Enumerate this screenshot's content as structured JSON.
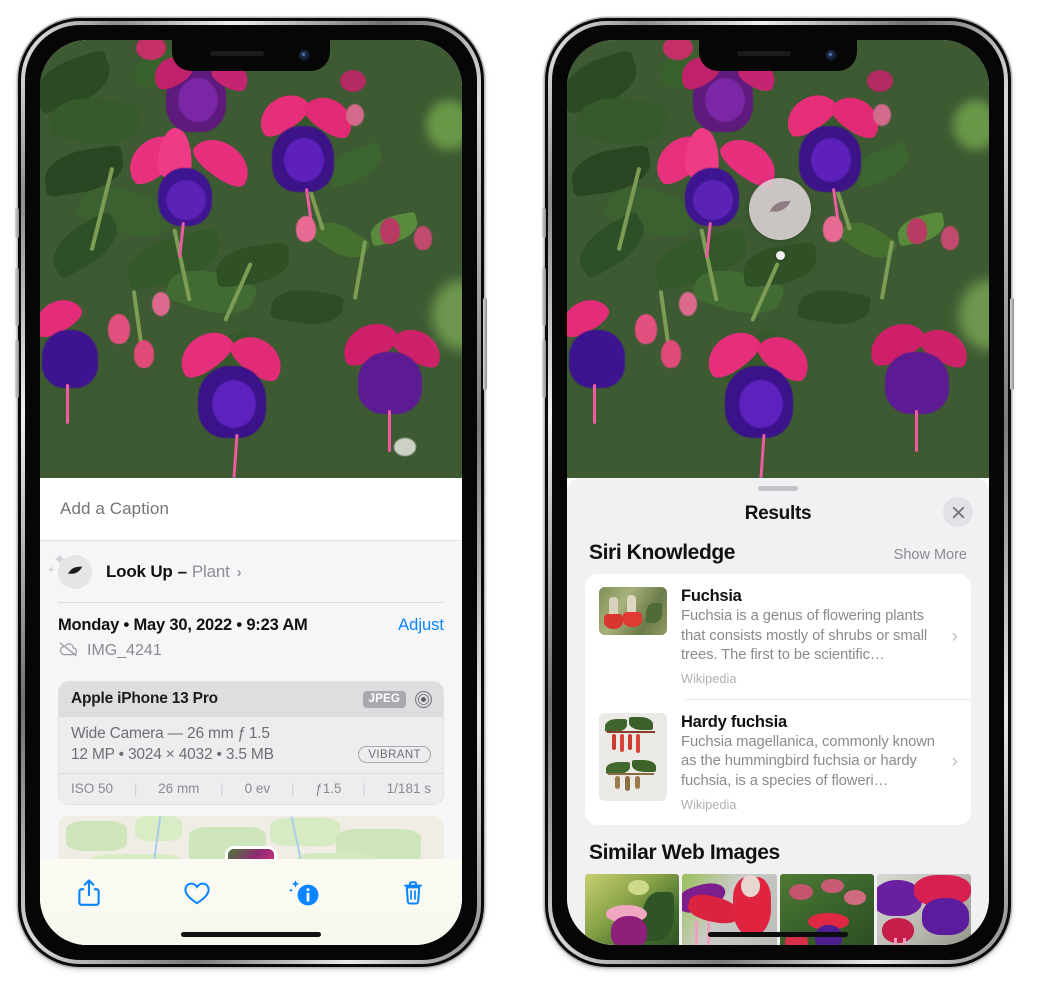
{
  "left_phone": {
    "photo": {
      "alt": "fuchsia-flowers-photo"
    },
    "caption": {
      "placeholder": "Add a Caption",
      "value": ""
    },
    "lookup": {
      "icon": "leaf-icon",
      "label": "Look Up",
      "dash": "–",
      "subject": "Plant",
      "chevron": "›"
    },
    "meta": {
      "date": "Monday • May 30, 2022 • 9:23 AM",
      "adjust_label": "Adjust",
      "cloud_icon": "cloud-slash-icon",
      "filename": "IMG_4241"
    },
    "camera": {
      "device": "Apple iPhone 13 Pro",
      "format_badge": "JPEG",
      "aperture_icon": "aperture-icon",
      "lens_line": "Wide Camera — 26 mm ƒ 1.5",
      "detail_line": "12 MP • 3024 × 4032 • 3.5 MB",
      "style_badge": "VIBRANT",
      "exif": [
        "ISO 50",
        "26 mm",
        "0 ev",
        "ƒ1.5",
        "1/181 s"
      ]
    },
    "toolbar": [
      {
        "name": "share-icon",
        "label": "Share"
      },
      {
        "name": "heart-icon",
        "label": "Favorite"
      },
      {
        "name": "info-sparkle-icon",
        "label": "Info"
      },
      {
        "name": "trash-icon",
        "label": "Delete"
      }
    ]
  },
  "right_phone": {
    "photo_badge": {
      "icon": "leaf-icon",
      "label": "Visual Look Up plant badge"
    },
    "sheet": {
      "grabber": "drag-handle",
      "title": "Results",
      "close_icon": "close-icon"
    },
    "siri_knowledge": {
      "title": "Siri Knowledge",
      "show_more": "Show More",
      "items": [
        {
          "title": "Fuchsia",
          "description": "Fuchsia is a genus of flowering plants that consists mostly of shrubs or small trees. The first to be scientific…",
          "source": "Wikipedia",
          "chevron": "›",
          "thumb": "fuchsia-red-flowers-thumbnail"
        },
        {
          "title": "Hardy fuchsia",
          "description": "Fuchsia magellanica, commonly known as the hummingbird fuchsia or hardy fuchsia, is a species of floweri…",
          "source": "Wikipedia",
          "chevron": "›",
          "thumb": "hardy-fuchsia-specimen-thumbnail"
        }
      ]
    },
    "similar_web_images": {
      "title": "Similar Web Images",
      "items": [
        {
          "name": "web-image-1"
        },
        {
          "name": "web-image-2"
        },
        {
          "name": "web-image-3"
        },
        {
          "name": "web-image-4"
        }
      ]
    }
  },
  "colors": {
    "accent_blue": "#0a84ff",
    "sheet_gray": "#f1f1f4",
    "secondary_text": "#8a8a8f"
  }
}
